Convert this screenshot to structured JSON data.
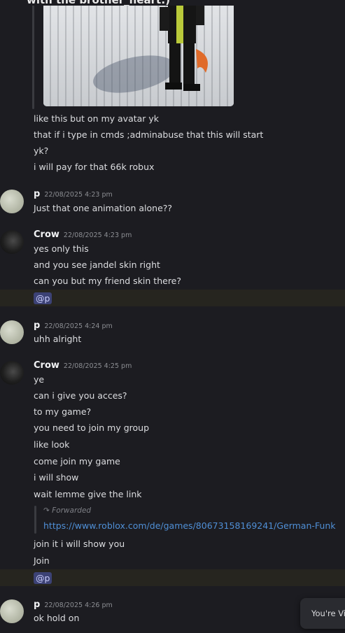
{
  "top_cut_text": "with the brother_heart:)",
  "embed_lines": [
    "like this but on my avatar yk",
    "that if i type in cmds ;adminabuse that this will start",
    "yk?",
    "i will pay for that 66k robux"
  ],
  "messages": [
    {
      "author": "p",
      "timestamp": "22/08/2025 4:23 pm",
      "lines": [
        "Just that one animation alone??"
      ]
    },
    {
      "author": "Crow",
      "timestamp": "22/08/2025 4:23 pm",
      "lines": [
        "yes only this",
        "and you see jandel skin right",
        "can you but my friend skin there?"
      ],
      "mention": "@p"
    },
    {
      "author": "p",
      "timestamp": "22/08/2025 4:24 pm",
      "lines": [
        "uhh alright"
      ]
    },
    {
      "author": "Crow",
      "timestamp": "22/08/2025 4:25 pm",
      "lines": [
        "ye",
        "can i give you acces?",
        "to my game?",
        "you need to join my group",
        "like look",
        "come join my game",
        "i will show",
        "wait lemme give the link"
      ],
      "forward_label": "Forwarded",
      "forward_link": "https://www.roblox.com/de/games/80673158169241/German-Funk",
      "after_lines": [
        "join it i will show you",
        "Join"
      ],
      "mention": "@p"
    },
    {
      "author": "p",
      "timestamp": "22/08/2025 4:26 pm",
      "lines": [
        "ok hold on"
      ]
    }
  ],
  "toast": "You're Vi",
  "colors": {
    "background": "#1c1c21",
    "link": "#4f8fd6",
    "mention_bg": "#3c4275",
    "highlight": "#26251f"
  }
}
